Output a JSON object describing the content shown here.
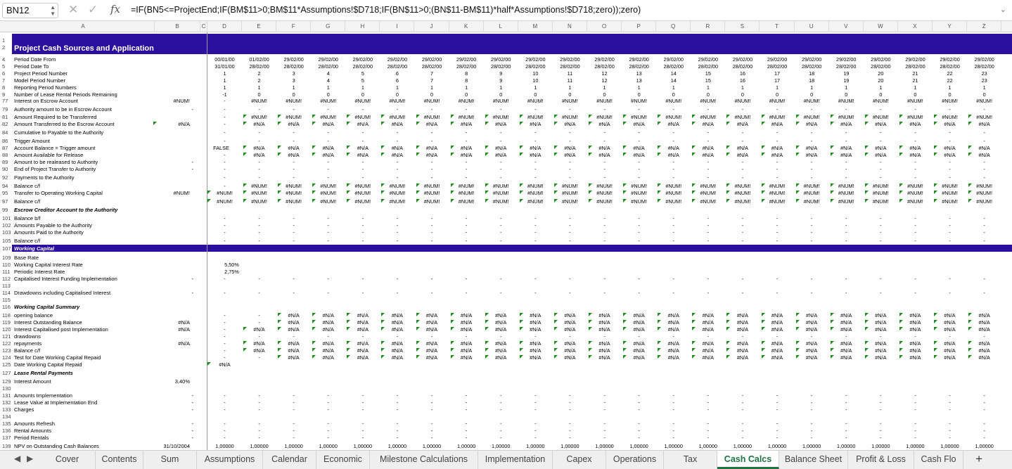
{
  "formula_bar": {
    "name_box": "BN12",
    "cancel_icon": "✕",
    "confirm_icon": "✓",
    "fx_label": "fx",
    "formula": "=IF(BN5<=ProjectEnd;IF(BM$11>0;BM$11*Assumptions!$D718;IF(BN$11>0;(BN$11-BM$11)*half*Assumptions!$D718;zero));zero)"
  },
  "columns": [
    "A",
    "B",
    "C",
    "D",
    "E",
    "F",
    "G",
    "H",
    "I",
    "J",
    "K",
    "L",
    "M",
    "N",
    "O",
    "P",
    "Q",
    "R",
    "S",
    "T",
    "U",
    "V",
    "W",
    "X",
    "Y",
    "Z"
  ],
  "title": "Project Cash Sources and Application",
  "header_rows": [
    {
      "n": "4",
      "label": "Period Date From",
      "vals": [
        "00/01/00",
        "01/02/00",
        "29/02/00",
        "29/02/00",
        "29/02/00",
        "29/02/00",
        "29/02/00",
        "29/02/00",
        "29/02/00",
        "29/02/00",
        "29/02/00",
        "29/02/00",
        "29/02/00",
        "29/02/00",
        "29/02/00",
        "29/02/00",
        "29/02/00",
        "29/02/00",
        "29/02/00",
        "29/02/00",
        "29/02/00",
        "29/02/00",
        "29/02/00",
        "2…"
      ]
    },
    {
      "n": "5",
      "label": "Period Date To",
      "vals": [
        "31/01/00",
        "28/02/00",
        "28/02/00",
        "28/02/00",
        "28/02/00",
        "28/02/00",
        "28/02/00",
        "28/02/00",
        "28/02/00",
        "28/02/00",
        "28/02/00",
        "28/02/00",
        "28/02/00",
        "28/02/00",
        "28/02/00",
        "28/02/00",
        "28/02/00",
        "28/02/00",
        "28/02/00",
        "28/02/00",
        "28/02/00",
        "28/02/00",
        "28/02/00",
        "2…"
      ]
    },
    {
      "n": "6",
      "label": "Project Period Number",
      "vals": [
        "1",
        "2",
        "3",
        "4",
        "5",
        "6",
        "7",
        "8",
        "9",
        "10",
        "11",
        "12",
        "13",
        "14",
        "15",
        "16",
        "17",
        "18",
        "19",
        "20",
        "21",
        "22",
        "23",
        ""
      ]
    },
    {
      "n": "7",
      "label": "Model Period Number",
      "vals": [
        "1",
        "2",
        "3",
        "4",
        "5",
        "6",
        "7",
        "8",
        "9",
        "10",
        "11",
        "12",
        "13",
        "14",
        "15",
        "16",
        "17",
        "18",
        "19",
        "20",
        "21",
        "22",
        "23",
        ""
      ]
    },
    {
      "n": "8",
      "label": "Reporting Period Numbers",
      "vals": [
        "1",
        "1",
        "1",
        "1",
        "1",
        "1",
        "1",
        "1",
        "1",
        "1",
        "1",
        "1",
        "1",
        "1",
        "1",
        "1",
        "1",
        "1",
        "1",
        "1",
        "1",
        "1",
        "1",
        ""
      ]
    },
    {
      "n": "9",
      "label": "Number of Lease Rental Periods Remaining",
      "vals": [
        "-1",
        "0",
        "0",
        "0",
        "0",
        "0",
        "0",
        "0",
        "0",
        "0",
        "0",
        "0",
        "0",
        "0",
        "0",
        "0",
        "0",
        "0",
        "0",
        "0",
        "0",
        "0",
        "0",
        ""
      ]
    }
  ],
  "body_rows": [
    {
      "n": "77",
      "label": "Interest on Escrow Account",
      "b": "#NUM!",
      "d": "-",
      "fill": "#NUM!"
    },
    {
      "n": "79",
      "label": "Authority amount to be in Escrow Account",
      "b": "-",
      "d": "-",
      "fill": "-"
    },
    {
      "n": "81",
      "label": "Amount Required to be Transferred",
      "b": "",
      "d": "-",
      "fill": "#NUM!",
      "tri": true
    },
    {
      "n": "82",
      "label": "Amount Transferred to the Escrow Account",
      "b": "#N/A",
      "d": "-",
      "fill": "#N/A",
      "tri": true,
      "btri": true
    },
    {
      "n": "84",
      "label": "Cumulative to Payable to the Authority",
      "b": "",
      "d": "-",
      "fill": "-"
    },
    {
      "n": "86",
      "label": "Trigger Amount",
      "b": "",
      "d": "-",
      "fill": "-"
    },
    {
      "n": "87",
      "label": "Account Balance = Trigger amount",
      "b": "",
      "d": "FALSE",
      "fill": "#N/A",
      "tri": true
    },
    {
      "n": "88",
      "label": "Amount Available for Release",
      "b": "",
      "d": "-",
      "fill": "#N/A",
      "tri": true
    },
    {
      "n": "89",
      "label": "Amount to be realeased to Authority",
      "b": "-",
      "d": "-",
      "fill": "-"
    },
    {
      "n": "90",
      "label": "End of Project Transfer to Authority",
      "b": "-",
      "d": "-",
      "fill": "-"
    },
    {
      "n": "92",
      "label": "Payments to the Authority",
      "b": "",
      "d": "-",
      "fill": "-"
    },
    {
      "n": "94",
      "label": "Balance c/f",
      "b": "",
      "d": "-",
      "fill": "#NUM!",
      "tri": true
    },
    {
      "n": "95",
      "label": "Transfer to Operating Working Capital",
      "b": "#NUM!",
      "d": "#NUM!",
      "fill": "#NUM!",
      "tri": true,
      "dtri": true
    },
    {
      "n": "97",
      "label": "Balance c/f",
      "b": "",
      "d": "#NUM!",
      "fill": "#NUM!",
      "tri": true,
      "dtri": true
    },
    {
      "n": "99",
      "label": "Escrow Creditor Account to the Authority",
      "b": "",
      "d": "",
      "fill": "",
      "bold": true
    },
    {
      "n": "101",
      "label": "Balance b/f",
      "b": "",
      "d": "-",
      "fill": "-"
    },
    {
      "n": "102",
      "label": "Amounts Payable to the Authority",
      "b": "",
      "d": "-",
      "fill": "-"
    },
    {
      "n": "103",
      "label": "Amounts Paid to the Authority",
      "b": "",
      "d": "-",
      "fill": "-"
    },
    {
      "n": "105",
      "label": "Balance c/f",
      "b": "",
      "d": "-",
      "fill": "-"
    },
    {
      "n": "107",
      "label": "Working Capital",
      "b": "",
      "d": "",
      "fill": "",
      "band": true
    },
    {
      "n": "109",
      "label": "Base Rate",
      "b": "",
      "d": "",
      "fill": ""
    },
    {
      "n": "110",
      "label": "Working Capital Interest Rate",
      "b": "",
      "d": "5,50%",
      "fill": ""
    },
    {
      "n": "111",
      "label": "Periodic Interest Rate",
      "b": "",
      "d": "2,75%",
      "fill": ""
    },
    {
      "n": "112",
      "label": "Capitalised Interest Funding Implementation",
      "b": "-",
      "d": "-",
      "fill": "-"
    },
    {
      "n": "113",
      "label": "",
      "b": "",
      "d": "",
      "fill": ""
    },
    {
      "n": "114",
      "label": "Drawdowns including Capitalised Interest",
      "b": "-",
      "d": "-",
      "fill": "-"
    },
    {
      "n": "115",
      "label": "",
      "b": "",
      "d": "",
      "fill": ""
    },
    {
      "n": "116",
      "label": "Working Capital Summary",
      "b": "",
      "d": "",
      "fill": "",
      "bold": true
    },
    {
      "n": "118",
      "label": "opening balance",
      "b": "",
      "d": "-",
      "e": "-",
      "fill": "#N/A",
      "tri": true,
      "from": 2
    },
    {
      "n": "119",
      "label": "Interest Outstanding Balance",
      "b": "#N/A",
      "d": "-",
      "e": "-",
      "fill": "#N/A",
      "tri": true,
      "from": 2
    },
    {
      "n": "120",
      "label": "Interest Capitalised post Implementation",
      "b": "#N/A",
      "d": "-",
      "fill": "#N/A",
      "tri": true
    },
    {
      "n": "121",
      "label": "drawdowns",
      "b": "",
      "d": "-",
      "fill": "-"
    },
    {
      "n": "122",
      "label": "repayments",
      "b": "#N/A",
      "d": "-",
      "fill": "#N/A",
      "tri": true
    },
    {
      "n": "123",
      "label": "Balance c/f",
      "b": "",
      "d": "-",
      "fill": "#N/A",
      "tri": true
    },
    {
      "n": "124",
      "label": "Test for Date Working Capital Repaid",
      "b": "",
      "d": "-",
      "e": "-",
      "fill": "#N/A",
      "tri": true,
      "from": 2
    },
    {
      "n": "125",
      "label": "Date Working Capital Repaid",
      "b": "",
      "d": "#N/A",
      "fill": "",
      "dtri": true
    },
    {
      "n": "127",
      "label": "Lease Rental Payments",
      "b": "",
      "d": "",
      "fill": "",
      "bold": true
    },
    {
      "n": "129",
      "label": "Interest Amount",
      "b": "3,40%",
      "d": "",
      "fill": ""
    },
    {
      "n": "130",
      "label": "",
      "b": "",
      "d": "",
      "fill": ""
    },
    {
      "n": "131",
      "label": "Amounts Implementation",
      "b": "-",
      "d": "-",
      "fill": "-"
    },
    {
      "n": "132",
      "label": "Lease Value at Implementation End",
      "b": "-",
      "d": "-",
      "fill": "-"
    },
    {
      "n": "133",
      "label": "Charges",
      "b": "-",
      "d": "-",
      "fill": "-"
    },
    {
      "n": "134",
      "label": "",
      "b": "",
      "d": "",
      "fill": ""
    },
    {
      "n": "135",
      "label": "Amounts Refresh",
      "b": "-",
      "d": "-",
      "fill": "-"
    },
    {
      "n": "136",
      "label": "Rental Amounts",
      "b": "-",
      "d": "-",
      "fill": "-"
    },
    {
      "n": "137",
      "label": "Period Rentals",
      "b": "-",
      "d": "-",
      "fill": "-"
    },
    {
      "n": "139",
      "label": "NPV on Outstanding Cash Balances",
      "b": "31/10/2004",
      "d": "1,00000",
      "fill": "1,00000"
    }
  ],
  "sheet_tabs": [
    "Cover",
    "Contents",
    "Sum",
    "Assumptions",
    "Calendar",
    "Economic",
    "Milestone Calculations",
    "Implementation",
    "Capex",
    "Operations",
    "Tax",
    "Cash Calcs",
    "Balance Sheet",
    "Profit & Loss",
    "Cash Flo"
  ],
  "active_tab": "Cash Calcs",
  "add_sheet_label": "+",
  "colors": {
    "band": "#2b0f9e",
    "active_tab": "#1f7244",
    "error_triangle": "#1e8e1e"
  }
}
